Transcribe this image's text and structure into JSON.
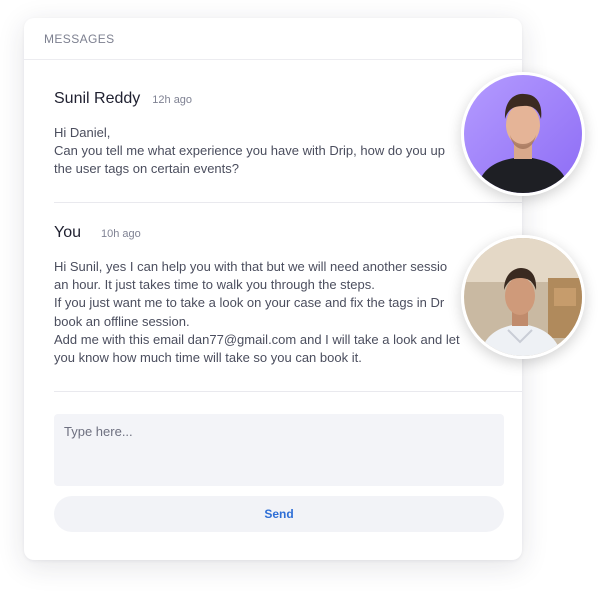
{
  "header": {
    "title": "MESSAGES"
  },
  "messages": [
    {
      "sender": "Sunil Reddy",
      "time": "12h ago",
      "lines": [
        "Hi Daniel,",
        "Can you tell me what experience you have with Drip, how do you up",
        "the user tags on certain events?"
      ]
    },
    {
      "sender": "You",
      "time": "10h ago",
      "lines": [
        "Hi Sunil, yes I can help you with that but we will need another sessio",
        "an hour. It just takes time to walk you through the steps.",
        "If you just want me to take a look on your case and fix the tags in Dr",
        "book an offline session.",
        "Add me with this email dan77@gmail.com and I will take a look and let",
        "you know how much time will take so you can book it."
      ]
    }
  ],
  "composer": {
    "placeholder": "Type here...",
    "value": "",
    "send_label": "Send"
  },
  "colors": {
    "accent": "#2f6fd6",
    "avatar1_bg": "#a98bff",
    "input_bg": "#f3f4f8"
  }
}
